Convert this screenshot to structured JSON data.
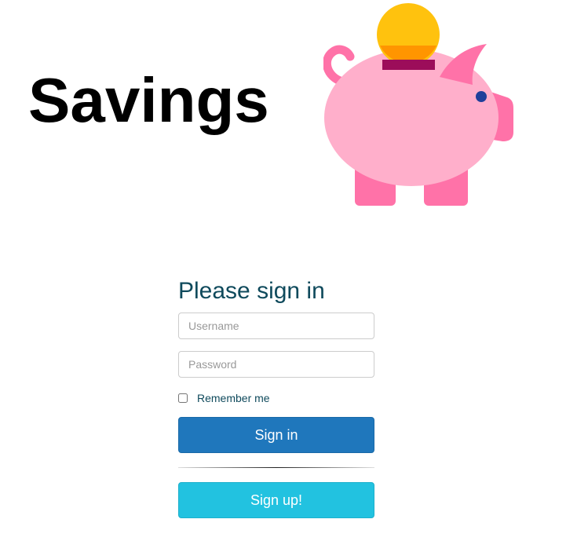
{
  "app": {
    "title": "Savings"
  },
  "illustration": {
    "icon": "piggy-bank-icon",
    "colors": {
      "pig_body": "#ffafcb",
      "pig_dark": "#ff72a8",
      "coin": "#ffc20e",
      "coin_shadow": "#ff9500",
      "slot": "#9c0d5a",
      "eye": "#1f3f9a"
    }
  },
  "signin": {
    "heading": "Please sign in",
    "username_placeholder": "Username",
    "username_value": "",
    "password_placeholder": "Password",
    "password_value": "",
    "remember_label": "Remember me",
    "remember_checked": false,
    "signin_button": "Sign in",
    "signup_button": "Sign up!"
  },
  "colors": {
    "heading_text": "#0f4a5c",
    "signin_button_bg": "#1f77bc",
    "signup_button_bg": "#22c2e0"
  }
}
